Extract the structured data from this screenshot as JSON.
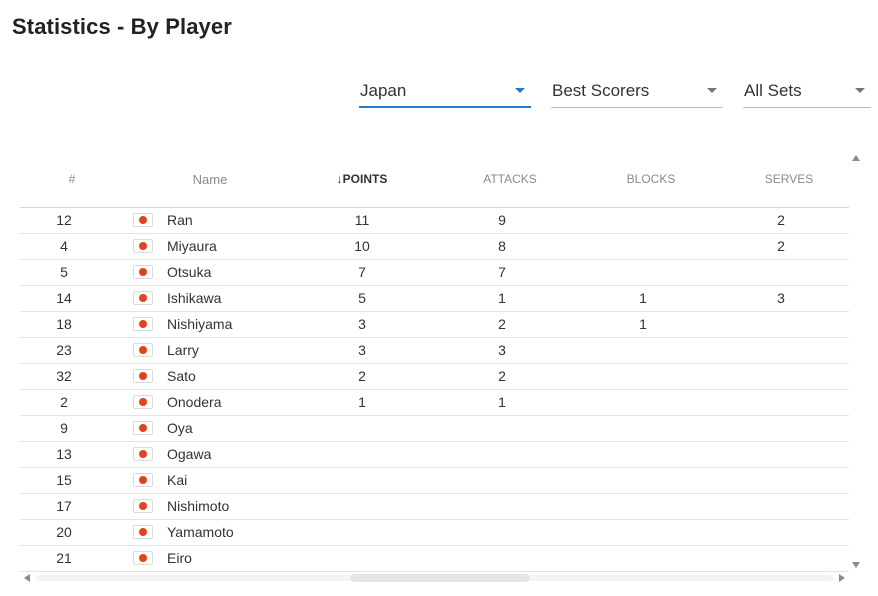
{
  "page": {
    "title": "Statistics - By Player"
  },
  "filters": {
    "country": {
      "value": "Japan"
    },
    "stat": {
      "value": "Best Scorers"
    },
    "sets": {
      "value": "All Sets"
    }
  },
  "table": {
    "headers": {
      "num": "#",
      "name": "Name",
      "points": "POINTS",
      "points_sort_arrow": "↓",
      "attacks": "ATTACKS",
      "blocks": "BLOCKS",
      "serves": "SERVES"
    },
    "rows": [
      {
        "num": "12",
        "name": "Ran",
        "points": "11",
        "attacks": "9",
        "blocks": "",
        "serves": "2"
      },
      {
        "num": "4",
        "name": "Miyaura",
        "points": "10",
        "attacks": "8",
        "blocks": "",
        "serves": "2"
      },
      {
        "num": "5",
        "name": "Otsuka",
        "points": "7",
        "attacks": "7",
        "blocks": "",
        "serves": ""
      },
      {
        "num": "14",
        "name": "Ishikawa",
        "points": "5",
        "attacks": "1",
        "blocks": "1",
        "serves": "3"
      },
      {
        "num": "18",
        "name": "Nishiyama",
        "points": "3",
        "attacks": "2",
        "blocks": "1",
        "serves": ""
      },
      {
        "num": "23",
        "name": "Larry",
        "points": "3",
        "attacks": "3",
        "blocks": "",
        "serves": ""
      },
      {
        "num": "32",
        "name": "Sato",
        "points": "2",
        "attacks": "2",
        "blocks": "",
        "serves": ""
      },
      {
        "num": "2",
        "name": "Onodera",
        "points": "1",
        "attacks": "1",
        "blocks": "",
        "serves": ""
      },
      {
        "num": "9",
        "name": "Oya",
        "points": "",
        "attacks": "",
        "blocks": "",
        "serves": ""
      },
      {
        "num": "13",
        "name": "Ogawa",
        "points": "",
        "attacks": "",
        "blocks": "",
        "serves": ""
      },
      {
        "num": "15",
        "name": "Kai",
        "points": "",
        "attacks": "",
        "blocks": "",
        "serves": ""
      },
      {
        "num": "17",
        "name": "Nishimoto",
        "points": "",
        "attacks": "",
        "blocks": "",
        "serves": ""
      },
      {
        "num": "20",
        "name": "Yamamoto",
        "points": "",
        "attacks": "",
        "blocks": "",
        "serves": ""
      },
      {
        "num": "21",
        "name": "Eiro",
        "points": "",
        "attacks": "",
        "blocks": "",
        "serves": ""
      }
    ]
  },
  "icons": {
    "flag": "japan-flag-icon",
    "dropdown": "caret-down-icon",
    "sort": "arrow-down-icon"
  },
  "colors": {
    "accent": "#1f7ac9",
    "flag_red": "#e5421b"
  }
}
